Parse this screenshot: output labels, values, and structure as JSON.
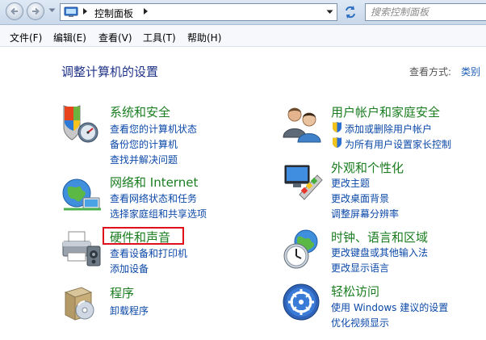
{
  "address_bar": {
    "path": "控制面板",
    "search_placeholder": "搜索控制面板"
  },
  "menu": [
    "文件(F)",
    "编辑(E)",
    "查看(V)",
    "工具(T)",
    "帮助(H)"
  ],
  "page_title": "调整计算机的设置",
  "view_by": {
    "label": "查看方式:",
    "value": "类别"
  },
  "categories": [
    {
      "heading": "系统和安全",
      "links": [
        "查看您的计算机状态",
        "备份您的计算机",
        "查找并解决问题"
      ]
    },
    {
      "heading": "网络和 Internet",
      "links": [
        "查看网络状态和任务",
        "选择家庭组和共享选项"
      ]
    },
    {
      "heading": "硬件和声音",
      "links": [
        "查看设备和打印机",
        "添加设备"
      ]
    },
    {
      "heading": "程序",
      "links": [
        "卸载程序"
      ]
    },
    {
      "heading": "用户帐户和家庭安全",
      "links": [
        "添加或删除用户帐户",
        "为所有用户设置家长控制"
      ]
    },
    {
      "heading": "外观和个性化",
      "links": [
        "更改主题",
        "更改桌面背景",
        "调整屏幕分辨率"
      ]
    },
    {
      "heading": "时钟、语言和区域",
      "links": [
        "更改键盘或其他输入法",
        "更改显示语言"
      ]
    },
    {
      "heading": "轻松访问",
      "links": [
        "使用 Windows 建议的设置",
        "优化视频显示"
      ]
    }
  ],
  "colors": {
    "heading_green": "#1a7d1f",
    "link_blue": "#0b48a8",
    "title_blue": "#1e3287",
    "highlight_red": "#e0101a"
  },
  "icons": {
    "system_security": "shield-icon",
    "network": "network-globe-icon",
    "hardware_sound": "printer-icon",
    "programs": "program-box-icon",
    "user_accounts": "users-icon",
    "appearance": "monitor-palette-icon",
    "clock_region": "clock-globe-icon",
    "ease_of_access": "ease-of-access-icon"
  }
}
